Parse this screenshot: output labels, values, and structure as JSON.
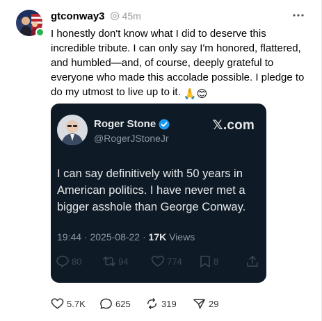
{
  "post": {
    "username": "gtconway3",
    "timestamp": "45m",
    "text": "I honestly don't know what I did to deserve this incredible tribute. I can only say I'm honored, flattered, and humbled—and, of course, deeply grateful to everyone who made this accolade possible. I pledge to do my utmost to live up to it.",
    "emojis": [
      "🙏",
      "😊"
    ],
    "online_color": "#2bb24a"
  },
  "embed": {
    "name": "Roger Stone",
    "handle": "@RogerJStoneJr",
    "brand": "𝕏.com",
    "text": "I can say definitively with 50 years in American politics. I have never met a bigger asshole than George Conway.",
    "meta_date": "19:44 · 2025-08-22 · ",
    "views_count": "17K",
    "views_label": " Views",
    "actions": {
      "replies": "80",
      "reposts": "94",
      "likes": "774",
      "bookmarks": "8"
    },
    "background": "#0e1a26",
    "verified_color": "#1d9bf0"
  },
  "actions": {
    "likes": "5.7K",
    "replies": "625",
    "reposts": "319",
    "shares": "29"
  }
}
